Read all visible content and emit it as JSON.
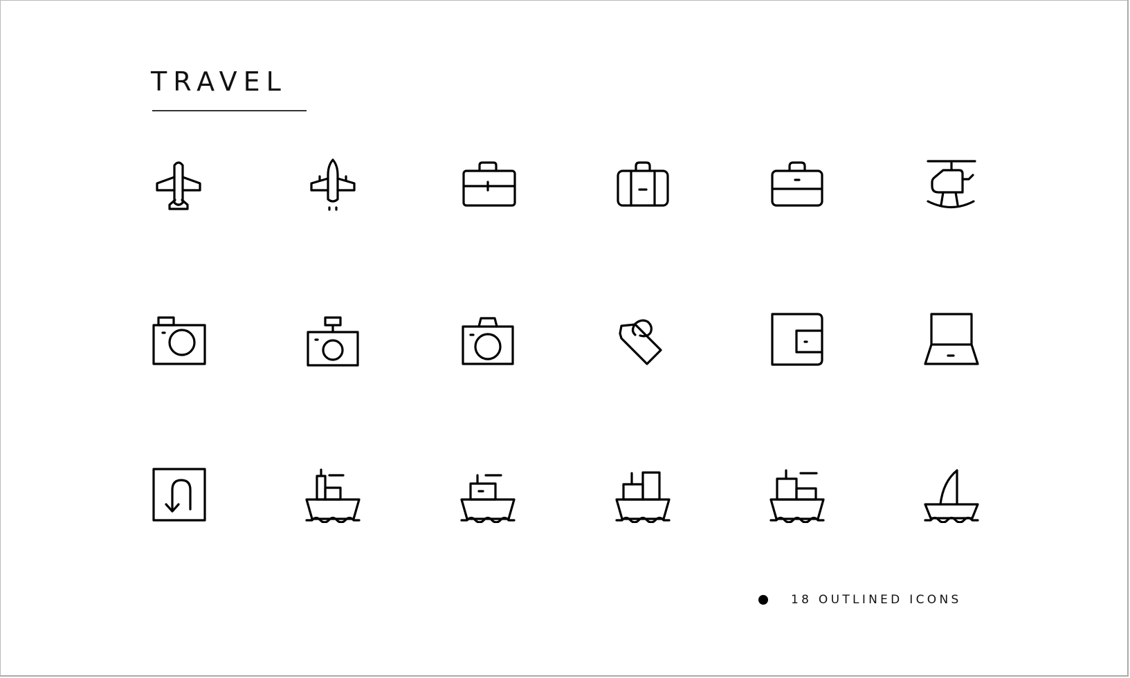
{
  "header": {
    "title": "TRAVEL"
  },
  "icons": [
    {
      "name": "airplane-top-view-icon",
      "row": 1,
      "col": 1
    },
    {
      "name": "jet-airplane-icon",
      "row": 1,
      "col": 2
    },
    {
      "name": "briefcase-icon",
      "row": 1,
      "col": 3
    },
    {
      "name": "suitcase-luggage-icon",
      "row": 1,
      "col": 4
    },
    {
      "name": "bag-icon",
      "row": 1,
      "col": 5
    },
    {
      "name": "helicopter-icon",
      "row": 1,
      "col": 6
    },
    {
      "name": "camera-icon",
      "row": 2,
      "col": 1
    },
    {
      "name": "camera-flash-icon",
      "row": 2,
      "col": 2
    },
    {
      "name": "photo-camera-icon",
      "row": 2,
      "col": 3
    },
    {
      "name": "luggage-tag-icon",
      "row": 2,
      "col": 4
    },
    {
      "name": "wallet-icon",
      "row": 2,
      "col": 5
    },
    {
      "name": "laptop-icon",
      "row": 2,
      "col": 6
    },
    {
      "name": "u-turn-sign-icon",
      "row": 3,
      "col": 1
    },
    {
      "name": "cargo-ship-icon",
      "row": 3,
      "col": 2
    },
    {
      "name": "boat-icon",
      "row": 3,
      "col": 3
    },
    {
      "name": "container-ship-icon",
      "row": 3,
      "col": 4
    },
    {
      "name": "freight-ship-icon",
      "row": 3,
      "col": 5
    },
    {
      "name": "sailboat-icon",
      "row": 3,
      "col": 6
    }
  ],
  "footer": {
    "bullet_icon": "filled-circle",
    "label": "18 OUTLINED ICONS"
  },
  "colors": {
    "background": "#ffffff",
    "icon_stroke": "#000000",
    "text": "#111111"
  }
}
